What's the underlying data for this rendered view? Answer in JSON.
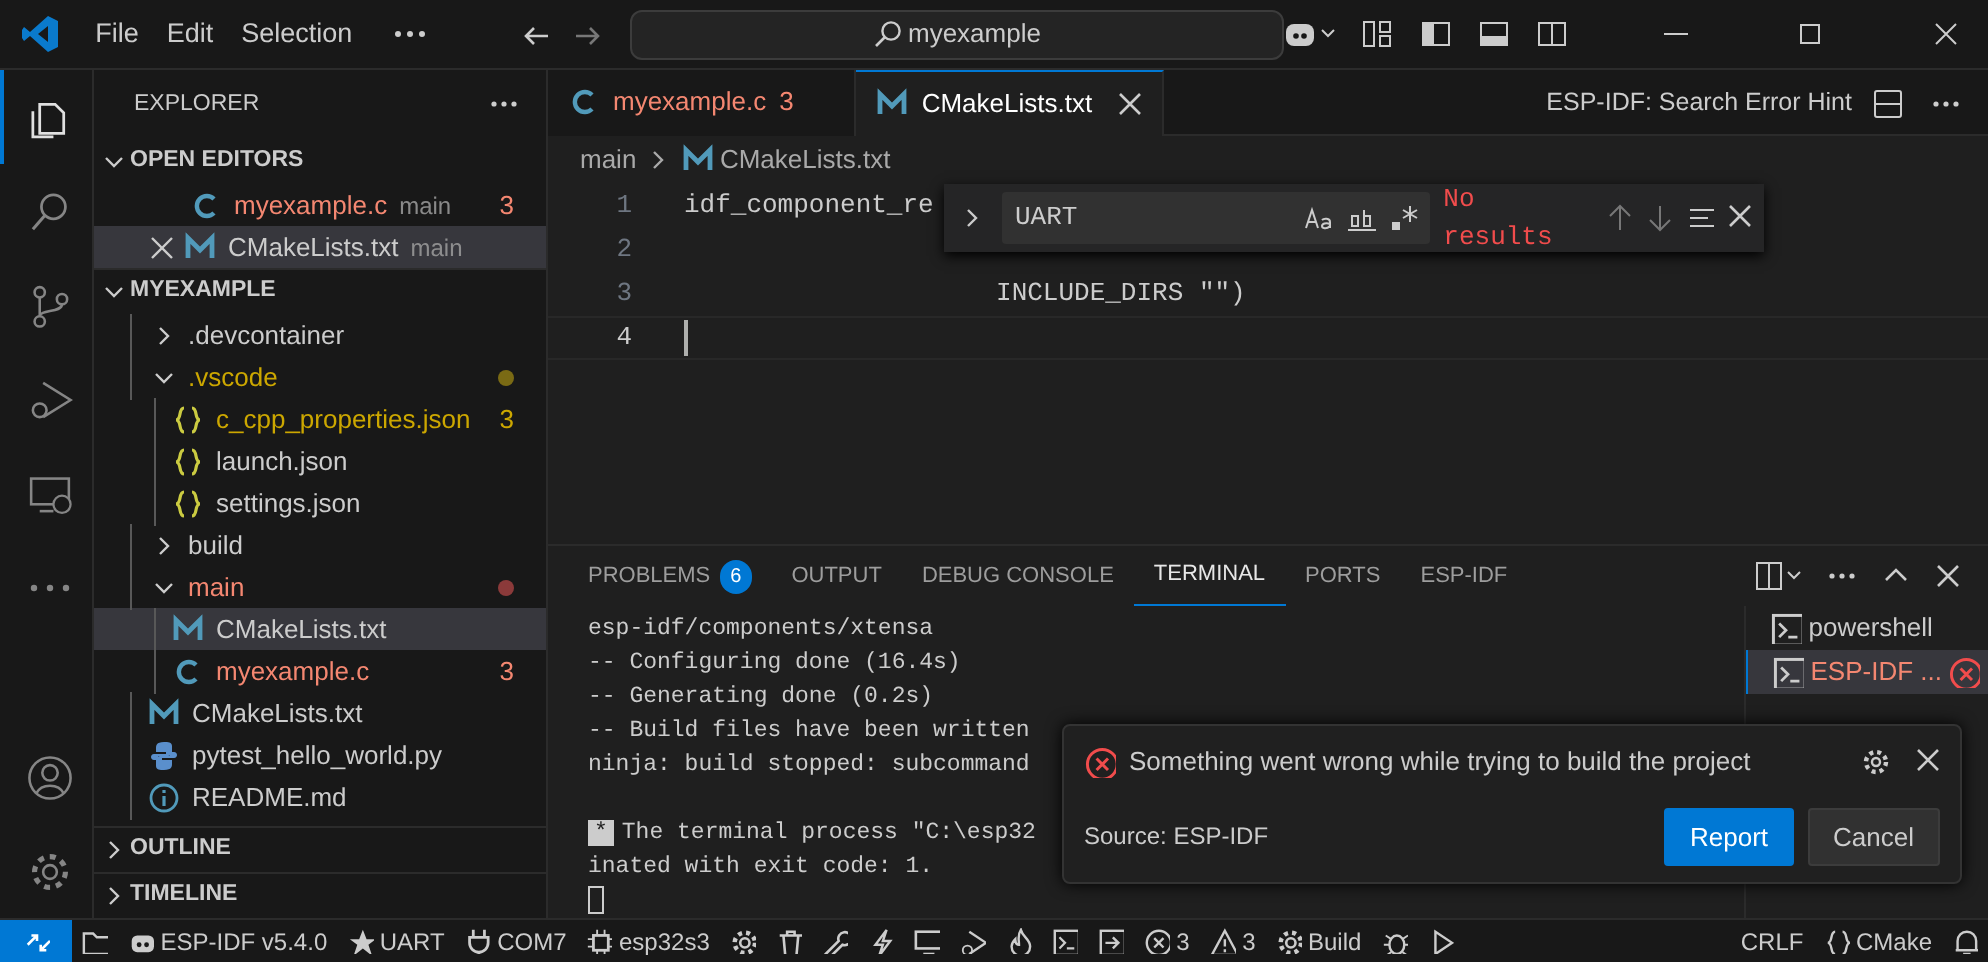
{
  "title_bar": {
    "menu": [
      "File",
      "Edit",
      "Selection"
    ],
    "search": "myexample"
  },
  "activity_bar": [
    {
      "kind": "files",
      "selected": true
    },
    {
      "kind": "search",
      "selected": false
    },
    {
      "kind": "source-control",
      "selected": false
    },
    {
      "kind": "run-debug",
      "selected": false
    },
    {
      "kind": "remote",
      "selected": false
    },
    {
      "kind": "more",
      "selected": false
    },
    {
      "kind": "account",
      "selected": false
    },
    {
      "kind": "settings",
      "selected": false
    }
  ],
  "sidebar": {
    "title": "EXPLORER",
    "open_editors": {
      "title": "OPEN EDITORS",
      "expanded": true,
      "items": [
        {
          "name": "myexample.c",
          "kind": "c",
          "folder": "main",
          "error": true,
          "badge": "3",
          "selected": false
        },
        {
          "name": "CMakeLists.txt",
          "kind": "cmake",
          "folder": "main",
          "selected": true
        }
      ]
    },
    "folder": {
      "title": "MYEXAMPLE",
      "expanded": true,
      "items": [
        {
          "name": ".devcontainer",
          "kind": "folder",
          "expanded": false,
          "selected": false
        },
        {
          "name": ".vscode",
          "kind": "folder",
          "expanded": true,
          "warning": true,
          "selected": false,
          "children": [
            {
              "name": "c_cpp_properties.json",
              "kind": "json",
              "warning": true,
              "badge": "3",
              "selected": false
            },
            {
              "name": "launch.json",
              "kind": "json",
              "selected": false
            },
            {
              "name": "settings.json",
              "kind": "json",
              "selected": false
            }
          ]
        },
        {
          "name": "build",
          "kind": "folder",
          "expanded": false,
          "selected": false
        },
        {
          "name": "main",
          "kind": "folder",
          "expanded": true,
          "error": true,
          "selected": false,
          "children": [
            {
              "name": "CMakeLists.txt",
              "kind": "cmake",
              "selected": true
            },
            {
              "name": "myexample.c",
              "kind": "c",
              "error": true,
              "badge": "3",
              "selected": false
            }
          ]
        },
        {
          "name": "CMakeLists.txt",
          "kind": "cmake",
          "selected": false
        },
        {
          "name": "pytest_hello_world.py",
          "kind": "python",
          "selected": false
        },
        {
          "name": "README.md",
          "kind": "info",
          "selected": false
        }
      ]
    },
    "sections": [
      {
        "title": "OUTLINE",
        "expanded": false
      },
      {
        "title": "TIMELINE",
        "expanded": false
      }
    ]
  },
  "editor": {
    "tabs": [
      {
        "label": "myexample.c",
        "kind": "c",
        "error": true,
        "badge": "3",
        "selected": false
      },
      {
        "label": "CMakeLists.txt",
        "kind": "cmake",
        "selected": true
      }
    ],
    "action": "ESP-IDF: Search Error Hint",
    "breadcrumbs": [
      {
        "label": "main",
        "kind": "folder"
      },
      {
        "label": "CMakeLists.txt",
        "kind": "cmake"
      }
    ],
    "lines": [
      {
        "number": "1",
        "text": "idf_component_re",
        "current": false
      },
      {
        "number": "2",
        "current": false
      },
      {
        "number": "3",
        "text": "                    INCLUDE_DIRS \"\")",
        "current": false
      },
      {
        "number": "4",
        "current": true
      }
    ],
    "find": {
      "query": "UART",
      "result": "No results"
    }
  },
  "panel": {
    "tabs": [
      {
        "label": "PROBLEMS",
        "badge": "6",
        "selected": false
      },
      {
        "label": "OUTPUT",
        "selected": false
      },
      {
        "label": "DEBUG CONSOLE",
        "selected": false
      },
      {
        "label": "TERMINAL",
        "selected": true
      },
      {
        "label": "PORTS",
        "selected": false
      },
      {
        "label": "ESP-IDF",
        "selected": false
      }
    ],
    "terminal_lines": [
      {
        "kind": "output",
        "text": "esp-idf/components/xtensa"
      },
      {
        "kind": "output",
        "text": "-- Configuring done (16.4s)"
      },
      {
        "kind": "output",
        "text": "-- Generating done (0.2s)"
      },
      {
        "kind": "output",
        "text": "-- Build files have been written"
      },
      {
        "kind": "output",
        "text": "ninja: build stopped: subcommand"
      },
      {
        "kind": "blank"
      },
      {
        "kind": "output",
        "text": "The terminal process \"C:\\esp32",
        "marker": "*"
      },
      {
        "kind": "output",
        "text": "inated with exit code: 1."
      }
    ],
    "terminals": [
      {
        "label": "powershell",
        "selected": false,
        "error": false
      },
      {
        "label": "ESP-IDF ...",
        "selected": true,
        "error": true
      }
    ]
  },
  "notification": {
    "message": "Something went wrong while trying to build the project",
    "source": "Source: ESP-IDF",
    "buttons": [
      {
        "label": "Report",
        "primary": true
      },
      {
        "label": "Cancel",
        "primary": false
      }
    ]
  },
  "status_bar": [
    {
      "kind": "remote"
    },
    {
      "kind": "folder"
    },
    {
      "kind": "esp",
      "text": "ESP-IDF v5.4.0"
    },
    {
      "kind": "star",
      "text": "UART"
    },
    {
      "kind": "plug",
      "text": "COM7"
    },
    {
      "kind": "chip",
      "text": "esp32s3"
    },
    {
      "kind": "gear"
    },
    {
      "kind": "trash"
    },
    {
      "kind": "wrench"
    },
    {
      "kind": "bolt"
    },
    {
      "kind": "monitor"
    },
    {
      "kind": "debug"
    },
    {
      "kind": "flame"
    },
    {
      "kind": "terminal"
    },
    {
      "kind": "exit"
    },
    {
      "kind": "error",
      "text": "3"
    },
    {
      "kind": "warning",
      "text": "3"
    },
    {
      "kind": "gear",
      "text": "Build"
    },
    {
      "kind": "bug"
    },
    {
      "kind": "play"
    },
    {
      "kind": "spacer"
    },
    {
      "kind": "plain",
      "text": "CRLF"
    },
    {
      "kind": "braces",
      "text": "CMake"
    },
    {
      "kind": "bell"
    }
  ]
}
